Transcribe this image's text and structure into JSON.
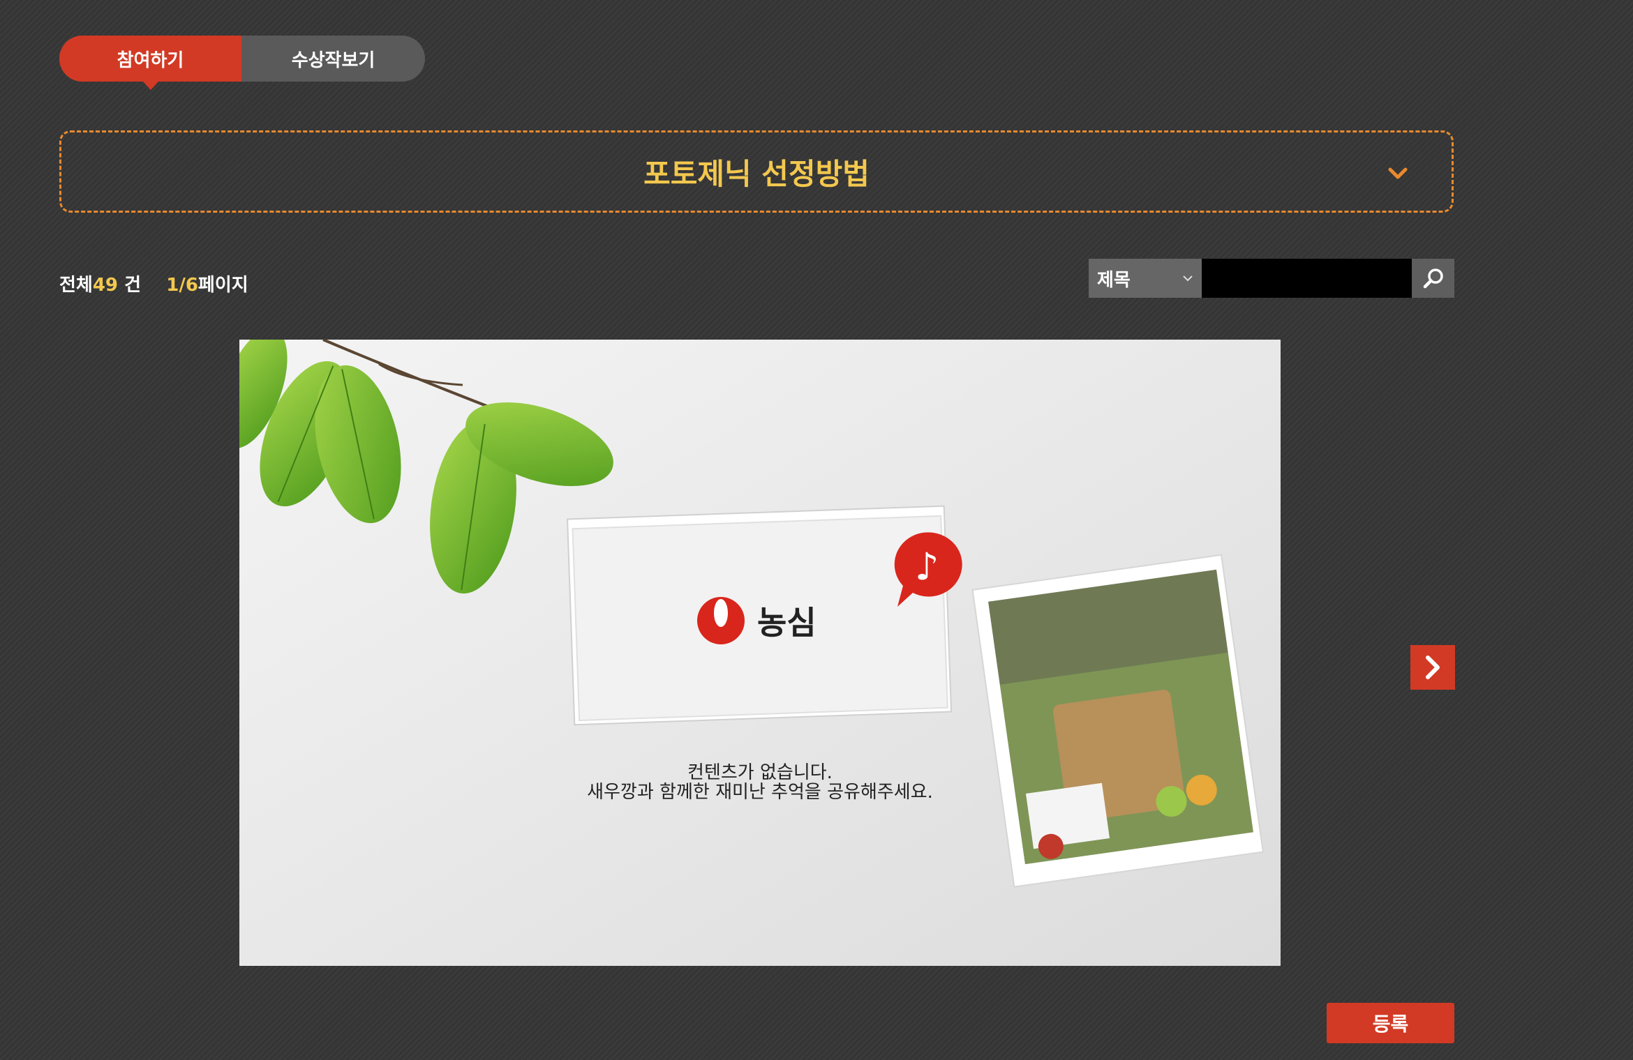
{
  "tabs": [
    {
      "label": "참여하기",
      "active": true
    },
    {
      "label": "수상작보기",
      "active": false
    }
  ],
  "guide": {
    "title": "포토제닉 선정방법"
  },
  "summary": {
    "total_prefix": "전체",
    "total_count": "49",
    "total_suffix": " 건",
    "page_current": "1/6",
    "page_suffix": "페이지"
  },
  "search": {
    "category_selected": "제목",
    "input_value": ""
  },
  "empty_state": {
    "brand": "농심",
    "line1": "컨텐츠가 없습니다.",
    "line2": "새우깡과 함께한 재미난 추억을 공유해주세요."
  },
  "actions": {
    "register_label": "등록"
  },
  "colors": {
    "accent_red": "#d23a25",
    "accent_yellow": "#f3c84f",
    "dashed_orange": "#e88a2e",
    "background": "#353535"
  }
}
